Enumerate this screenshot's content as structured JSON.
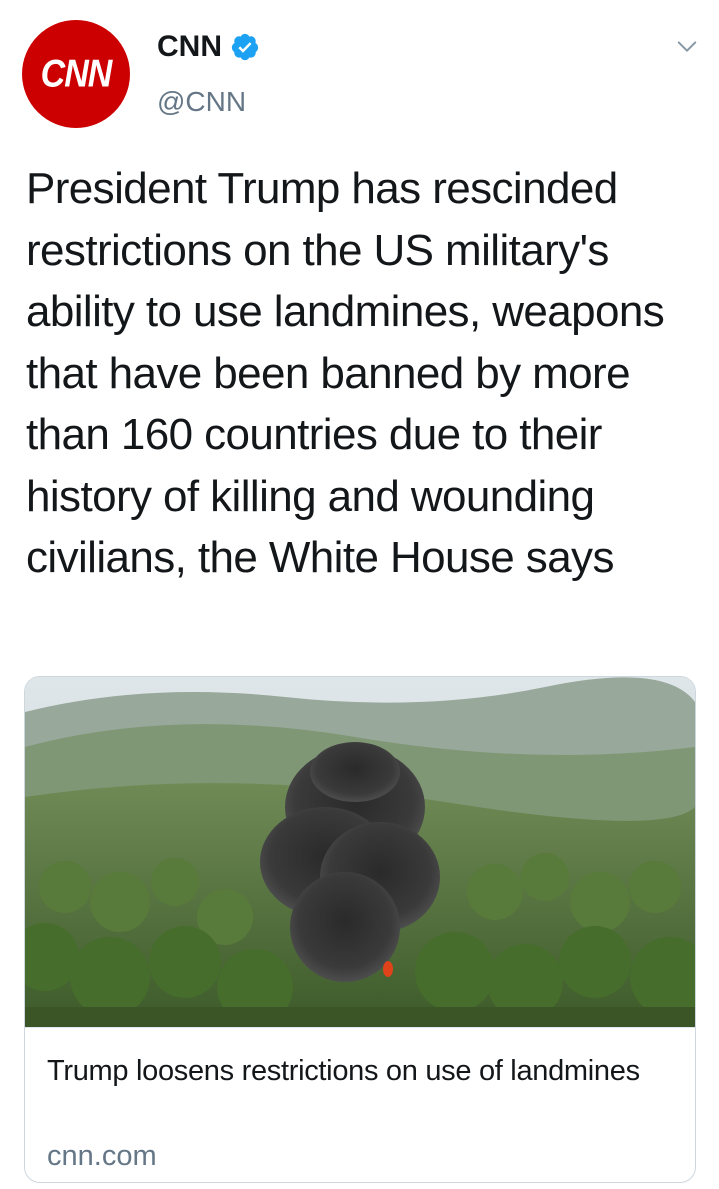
{
  "author": {
    "avatar_text": "CNN",
    "display_name": "CNN",
    "handle": "@CNN",
    "verified": true,
    "verified_icon": "verified-badge-icon",
    "brand_color": "#cc0000"
  },
  "menu_icon": "chevron-down-icon",
  "tweet": {
    "text": "President Trump has rescinded restrictions on the US military's ability to use landmines, weapons that have been banned by more than 160 countries due to their history of killing and wounding civilians, the White House says"
  },
  "link_card": {
    "image_alt": "photo-smoke-plume-over-forest",
    "title": "Trump loosens restrictions on use of landmines",
    "domain": "cnn.com"
  },
  "colors": {
    "text": "#14171a",
    "secondary_text": "#657786",
    "verified_blue": "#1da1f2",
    "border": "#ccd6dd"
  }
}
